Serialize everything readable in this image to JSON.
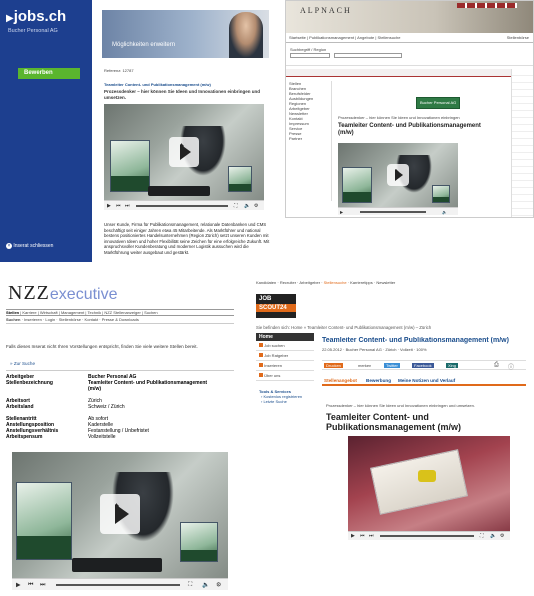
{
  "colors": {
    "jobs_blue": "#1d3f8f",
    "jobs_green": "#5ab52e",
    "nzz_blue": "#7a8fd1",
    "jobscout_orange": "#e06a1a",
    "jobscout_dark": "#222222",
    "link_blue": "#1a4d8c"
  },
  "jobs_ch": {
    "logo": "jobs.ch",
    "company": "Bucher Personal AG",
    "apply_button": "Bewerben",
    "close_link": "Inserat schliessen",
    "banner_text": "Möglichkeiten erweitern",
    "ref_text": "Referenz: 12787",
    "job_title": "Teamleiter Content- und Publikationsmanagement (m/w)",
    "intro": "Prozessdenker – hier können Sie Ideen und Innovationen einbringen und umsetzen.",
    "body": "Unser Kunde, Firma für Publikationsmanagement, relationale Datenbanken und CMS beschäftigt seit einiger Jahren etwa 45 Mitarbeitende. Als Marktführer und national bestens positioniertes Handelsunternehmen (Region Zürich) setzt unseren Kunden mit innovativen Ideen und hoher Flexibilität seine Zeichen für eine erfolgreiche Zukunft. Mit anspruchsvoller Kundenberatung und moderner Logistik aussuchen wird die Marktführung weiter ausgebaut und gestärkt."
  },
  "alpnach": {
    "logo": "ALPNACH",
    "nav_items": [
      "Startseite",
      "Publikationsmanagement",
      "Angebote",
      "Stellensuche",
      "Stellenbörse"
    ],
    "search_label": "Suchbegriff / Region",
    "sidebar_items": [
      "Stellen",
      "Branchen",
      "Berufsfelder",
      "Ausbildungen",
      "Regionen",
      "Arbeitgeber",
      "Newsletter",
      "Kontakt",
      "Impressum",
      "Service",
      "Presse",
      "Partner"
    ],
    "logo_badge": "Bucher Personal AG",
    "job_title": "Teamleiter Content- und Publikationsmanagement (m/w)",
    "subtitle": "Prozessdenker – hier können Sie Ideen und Innovationen einbringen"
  },
  "nzz": {
    "logo_main": "NZZ",
    "logo_sub": "executive",
    "nav_items": [
      "Stellen",
      "Karriere",
      "Wirtschaft",
      "Management",
      "Technik",
      "NZZ Stellenanzeiger",
      "Suchen"
    ],
    "subnav_items": [
      "Suchen",
      "Inserieren",
      "Login",
      "Stellenbörse",
      "Kontakt",
      "Presse & Downloads"
    ],
    "notice": "Falls dieses Inserat nicht Ihren Vorstellungen entspricht, finden Sie viele weitere Stellen bereit.",
    "back_link": "» Zur Suche",
    "fields": [
      {
        "label": "Arbeitgeber",
        "value": "Bucher Personal AG"
      },
      {
        "label": "Stellenbezeichnung",
        "value": "Teamleiter Content- und Publikationsmanagement (m/w)"
      },
      {
        "label": "Arbeitsort",
        "value": "Zürich"
      },
      {
        "label": "Arbeitsland",
        "value": "Schweiz / Zürich"
      },
      {
        "label": "Stellenantritt",
        "value": "Ab sofort"
      },
      {
        "label": "Anstellungsposition",
        "value": "Kaderstelle"
      },
      {
        "label": "Anstellungsverhältnis",
        "value": "Festanstellung / Unbefristet"
      },
      {
        "label": "Arbeitspensum",
        "value": "Vollzeitstelle"
      }
    ]
  },
  "jobscout": {
    "logo_top": "JOB",
    "logo_bottom": "SCOUT24",
    "topnav": [
      "Kandidaten",
      "Recruiter",
      "Arbeitgeber",
      "Stellensuche",
      "Karrieretipps",
      "Newsletter"
    ],
    "breadcrumb": "Sie befinden sich: Home » Teamleiter Content- und Publikationsmanagement (m/w) – Zürich",
    "sidebar_header": "Home",
    "sidebar_items": [
      "Job suchen",
      "Job Ratgeber",
      "Inserieren",
      "Über uns"
    ],
    "services_header": "Tools & Services",
    "services_items": [
      "Kostenlos registrieren",
      "Letzte Suche"
    ],
    "job_title": "Teamleiter Content- und Publikationsmanagement (m/w)",
    "meta": "22.05.2012 · Bucher Personal AG · Zürich · Vollzeit · 100%",
    "share_buttons": [
      "Drucken",
      "merken",
      "Twitter",
      "Facebook",
      "Xing"
    ],
    "tabs": [
      "Stellenangebot",
      "Bewerbung",
      "Meine Notizen und Verlauf"
    ],
    "intro": "Prozessdenker – hier können Sie Ideen und Innovationen einbringen und umsetzen.",
    "big_title": "Teamleiter Content- und Publikationsmanagement (m/w)"
  }
}
